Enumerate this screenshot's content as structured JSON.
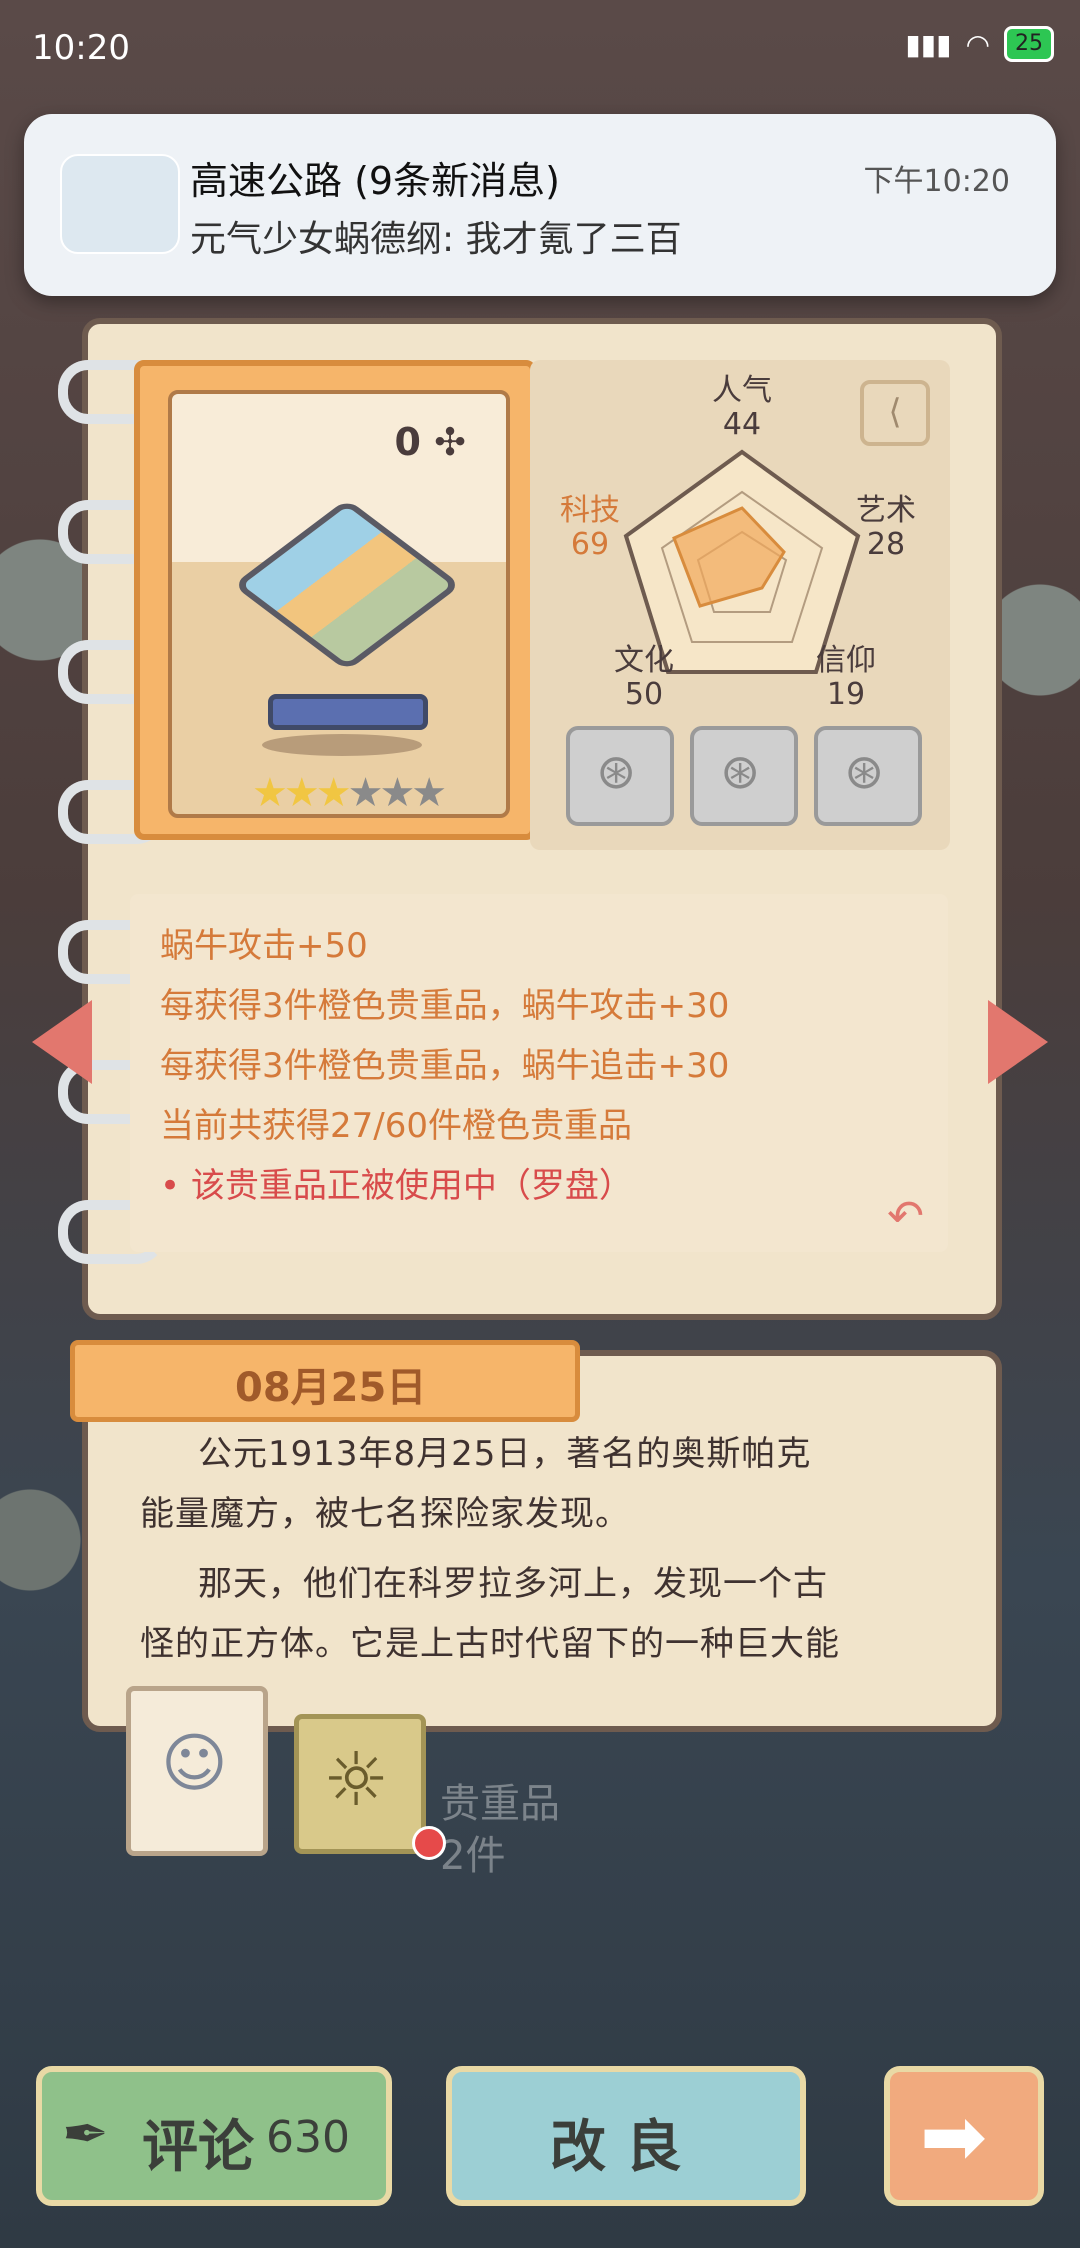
{
  "status_bar": {
    "time": "10:20",
    "battery": "25"
  },
  "notification": {
    "title": "高速公路 (9条新消息)",
    "body": "元气少女蜗德纲: 我才氪了三百",
    "time": "下午10:20"
  },
  "item_card": {
    "count": "0",
    "stars_filled": 3,
    "stars_total": 6
  },
  "stats": {
    "popularity": {
      "label": "人气",
      "value": "44"
    },
    "technology": {
      "label": "科技",
      "value": "69"
    },
    "art": {
      "label": "艺术",
      "value": "28"
    },
    "culture": {
      "label": "文化",
      "value": "50"
    },
    "faith": {
      "label": "信仰",
      "value": "19"
    }
  },
  "description": {
    "lines": [
      "蜗牛攻击+50",
      "每获得3件橙色贵重品，蜗牛攻击+30",
      "每获得3件橙色贵重品，蜗牛追击+30",
      "当前共获得27/60件橙色贵重品",
      "该贵重品正被使用中（罗盘）"
    ]
  },
  "story": {
    "date": "08月25日",
    "lines": [
      "公元1913年8月25日，著名的奥斯帕克",
      "能量魔方，被七名探险家发现。",
      "那天，他们在科罗拉多河上，发现一个古",
      "怪的正方体。它是上古时代留下的一种巨大能"
    ]
  },
  "background_text": {
    "line1": "贵重品",
    "line2": "2件"
  },
  "buttons": {
    "comment_label": "评论",
    "comment_count": "630",
    "improve_label": "改 良"
  },
  "colors": {
    "accent_orange": "#f6b56a",
    "warning_red": "#d84b4b",
    "text_orange": "#d57a3a"
  }
}
